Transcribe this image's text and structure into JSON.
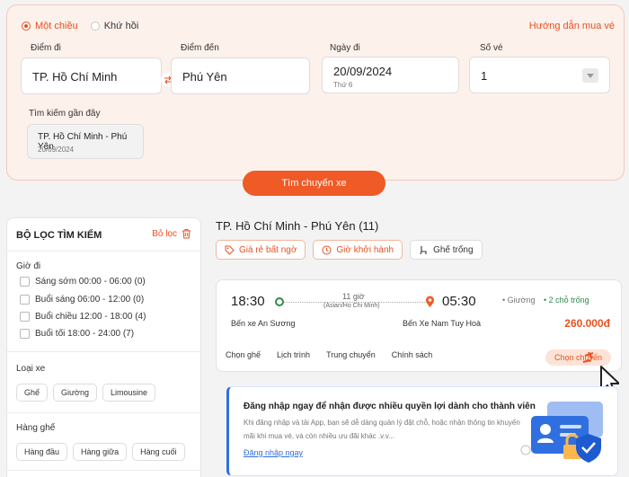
{
  "search": {
    "trip_types": [
      {
        "label": "Một chiều",
        "checked": true
      },
      {
        "label": "Khứ hồi",
        "checked": false
      }
    ],
    "guide_link": "Hướng dẫn mua vé",
    "from_label": "Điểm đi",
    "from_value": "TP. Hồ Chí Minh",
    "to_label": "Điểm đến",
    "to_value": "Phú Yên",
    "date_label": "Ngày đi",
    "date_value": "20/09/2024",
    "date_weekday": "Thứ 6",
    "tickets_label": "Số vé",
    "tickets_value": "1",
    "recent_label": "Tìm kiếm gần đây",
    "recent": {
      "route": "TP. Hồ Chí Minh - Phú Yên",
      "date": "20/09/2024"
    },
    "button": "Tìm chuyến xe"
  },
  "filter": {
    "title": "BỘ LỌC TÌM KIẾM",
    "clear": "Bỏ lọc",
    "time_group": "Giờ đi",
    "times": [
      "Sáng sớm 00:00 - 06:00 (0)",
      "Buổi sáng 06:00 - 12:00 (0)",
      "Buổi chiều 12:00 - 18:00 (4)",
      "Buổi tối 18:00 - 24:00 (7)"
    ],
    "vehicle_group": "Loại xe",
    "vehicles": [
      "Ghế",
      "Giường",
      "Limousine"
    ],
    "row_group": "Hàng ghế",
    "rows": [
      "Hàng đầu",
      "Hàng giữa",
      "Hàng cuối"
    ]
  },
  "results": {
    "title": "TP. Hồ Chí Minh - Phú Yên (11)",
    "sort": [
      "Giá rẻ bất ngờ",
      "Giờ khởi hành",
      "Ghế trống"
    ]
  },
  "trip": {
    "depart_time": "18:30",
    "arrive_time": "05:30",
    "duration": "11 giờ",
    "timezone": "(Asian/Ho Chi Minh)",
    "from_station": "Bến xe An Sương",
    "to_station": "Bến Xe Nam Tuy Hoà",
    "vehicle_type": "• Giường",
    "seats_left": "• 2 chỗ trống",
    "price": "260.000đ",
    "tabs": [
      "Chọn ghế",
      "Lịch trình",
      "Trung chuyển",
      "Chính sách"
    ],
    "choose_button": "Chọn chuyến"
  },
  "promo": {
    "title": "Đăng nhập ngay để nhận được nhiều quyền lợi dành cho thành viên",
    "text": "Khi đăng nhập và tải App, bạn sẽ dễ dàng quản lý đặt chỗ, hoặc nhận thông tin khuyến mãi khi mua vé, và còn nhiều ưu đãi khác .v.v...",
    "link": "Đăng nhập ngay"
  },
  "colors": {
    "accent": "#ef5a26",
    "success": "#2f8a4c",
    "link_blue": "#2f6fe0"
  }
}
